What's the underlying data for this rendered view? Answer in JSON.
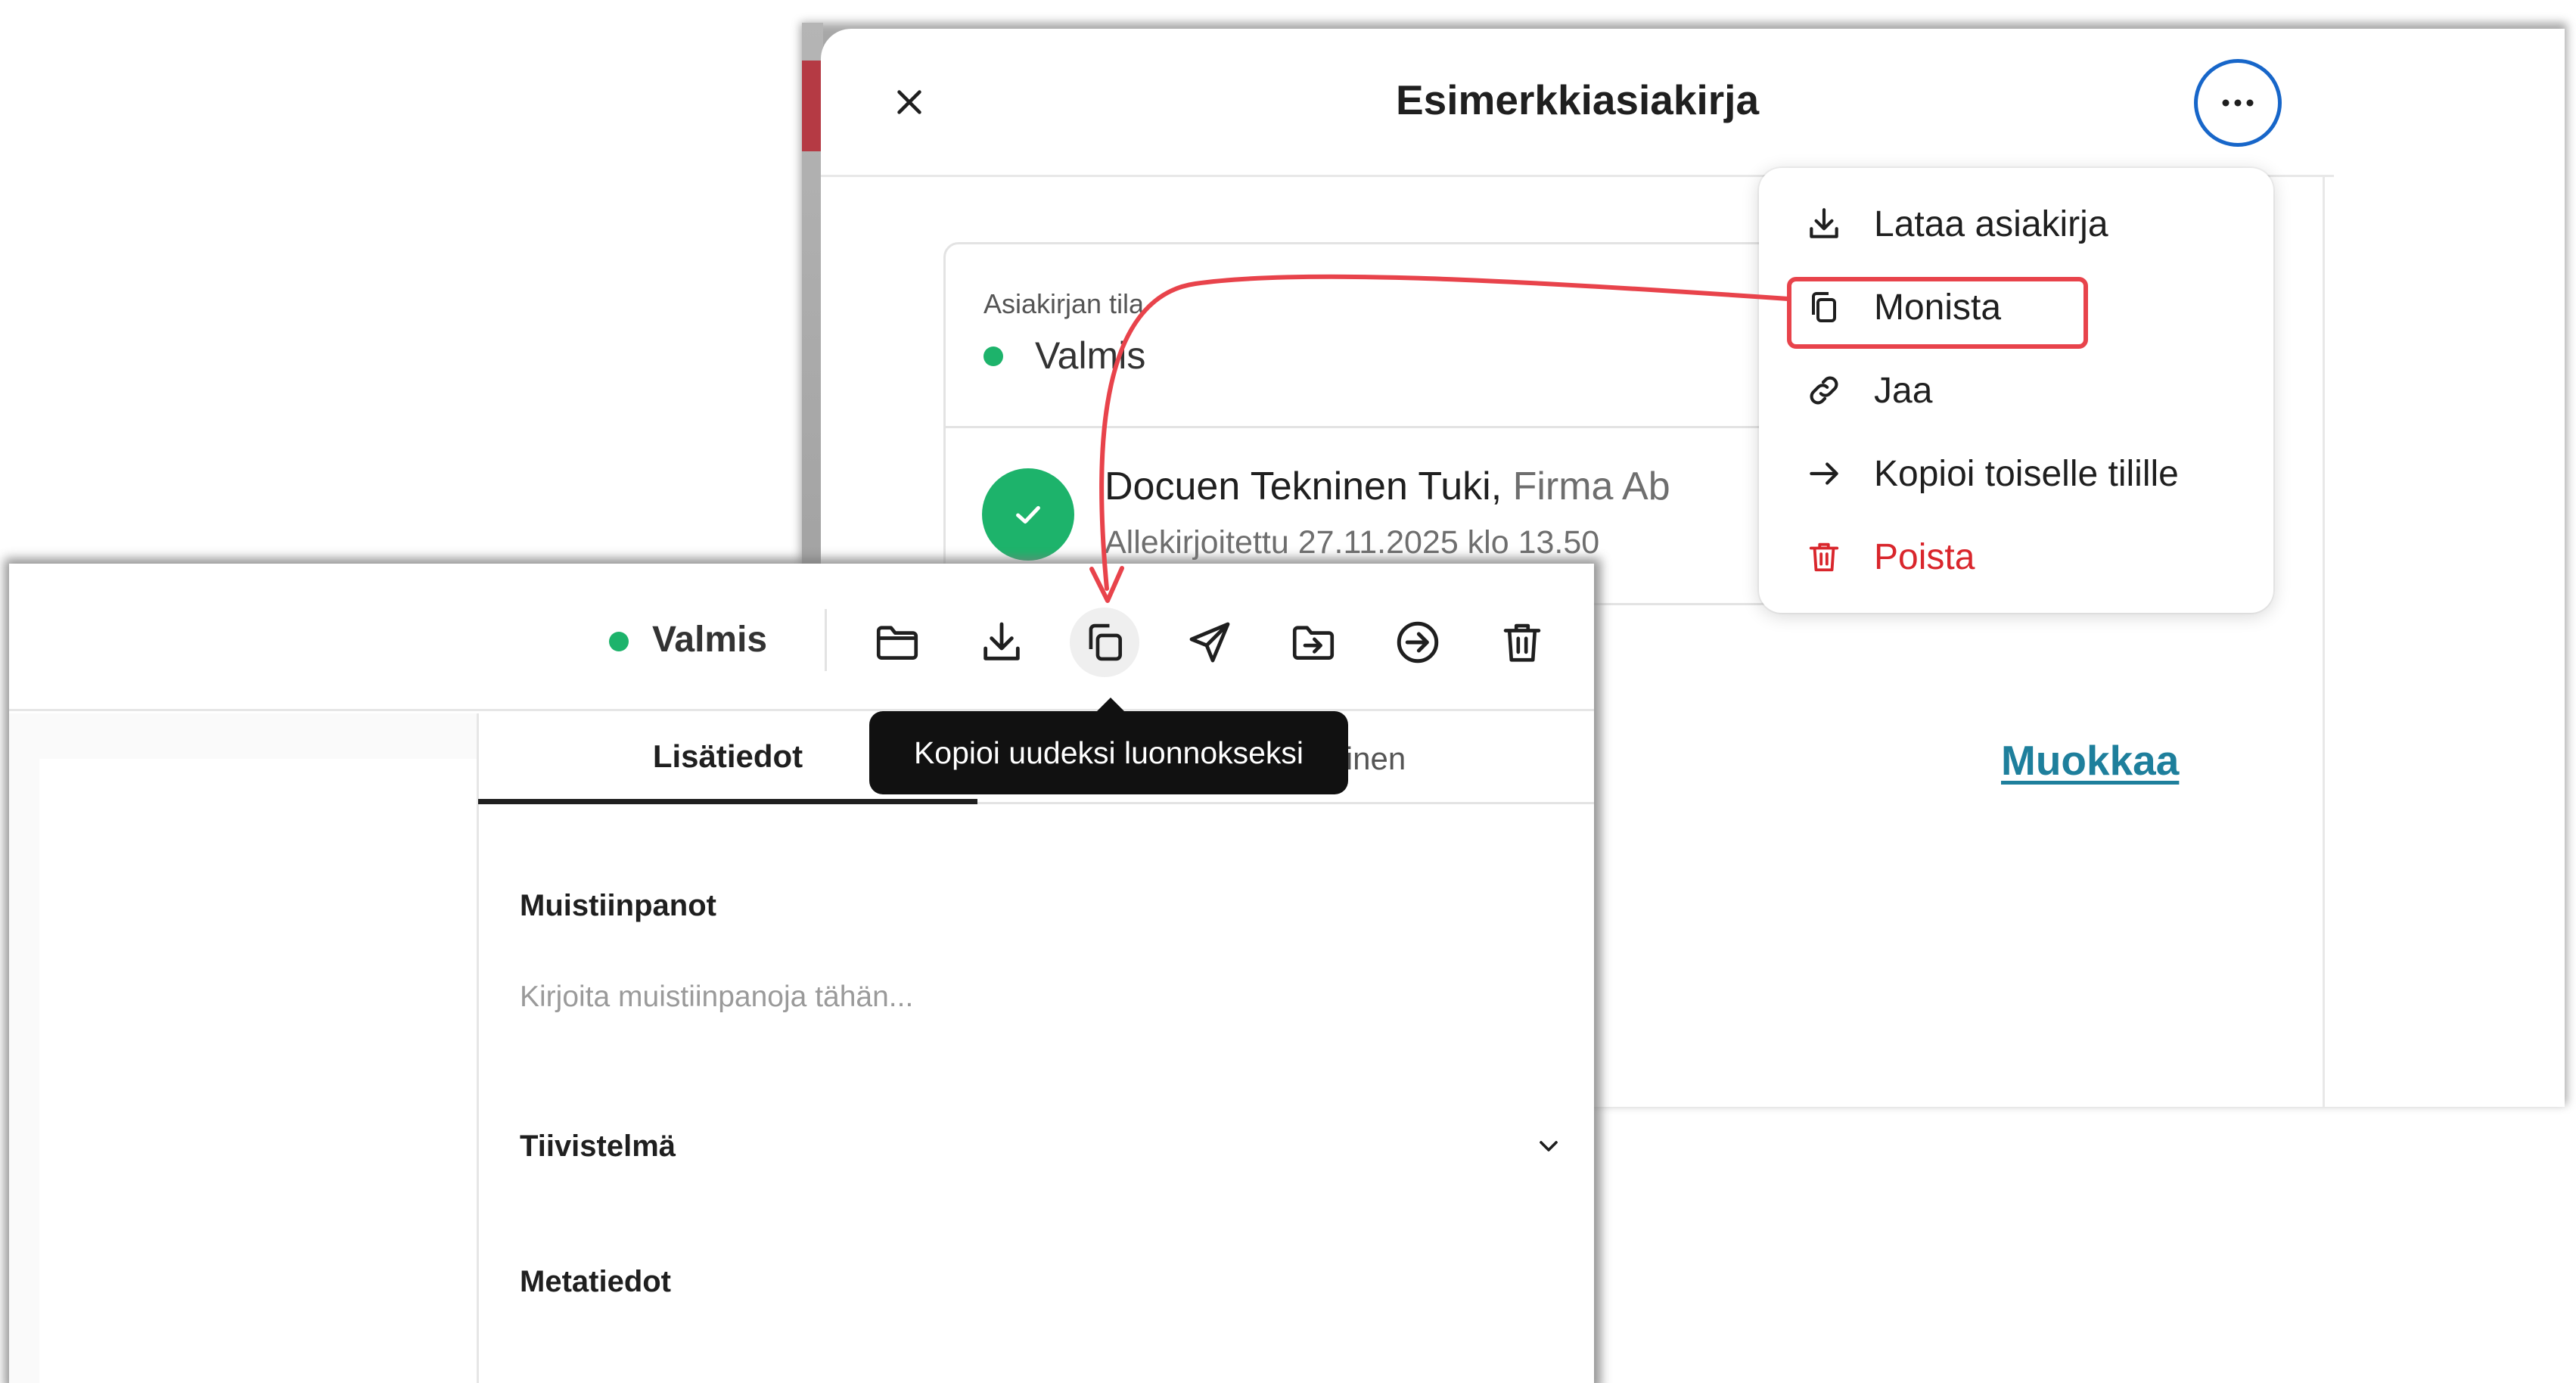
{
  "modal": {
    "title": "Esimerkkiasiakirja",
    "status_label": "Asiakirjan tila",
    "status_value": "Valmis",
    "signer_name": "Docuen Tekninen Tuki,",
    "signer_company": "Firma Ab",
    "signer_signed": "Allekirjoitettu 27.11.2025 klo 13.50",
    "edit_link": "Muokkaa"
  },
  "menu": {
    "items": [
      {
        "label": "Lataa asiakirja",
        "icon": "download-icon"
      },
      {
        "label": "Monista",
        "icon": "duplicate-icon"
      },
      {
        "label": "Jaa",
        "icon": "link-icon"
      },
      {
        "label": "Kopioi toiselle tilille",
        "icon": "arrow-right-icon"
      },
      {
        "label": "Poista",
        "icon": "trash-icon"
      }
    ]
  },
  "toolbar": {
    "status": "Valmis",
    "tooltip": "Kopioi uudeksi luonnokseksi"
  },
  "side": {
    "tabs": [
      "Lisätiedot",
      "Allekirjoittaminen"
    ],
    "notes_title": "Muistiinpanot",
    "notes_placeholder": "Kirjoita muistiinpanoja tähän...",
    "summary_title": "Tiivistelmä",
    "metadata_title": "Metatiedot"
  },
  "colors": {
    "accent_blue": "#1766c9",
    "status_green": "#1db36b",
    "danger_red": "#d9262c",
    "annotation_red": "#e8434b",
    "link_teal": "#1e7f9c"
  }
}
